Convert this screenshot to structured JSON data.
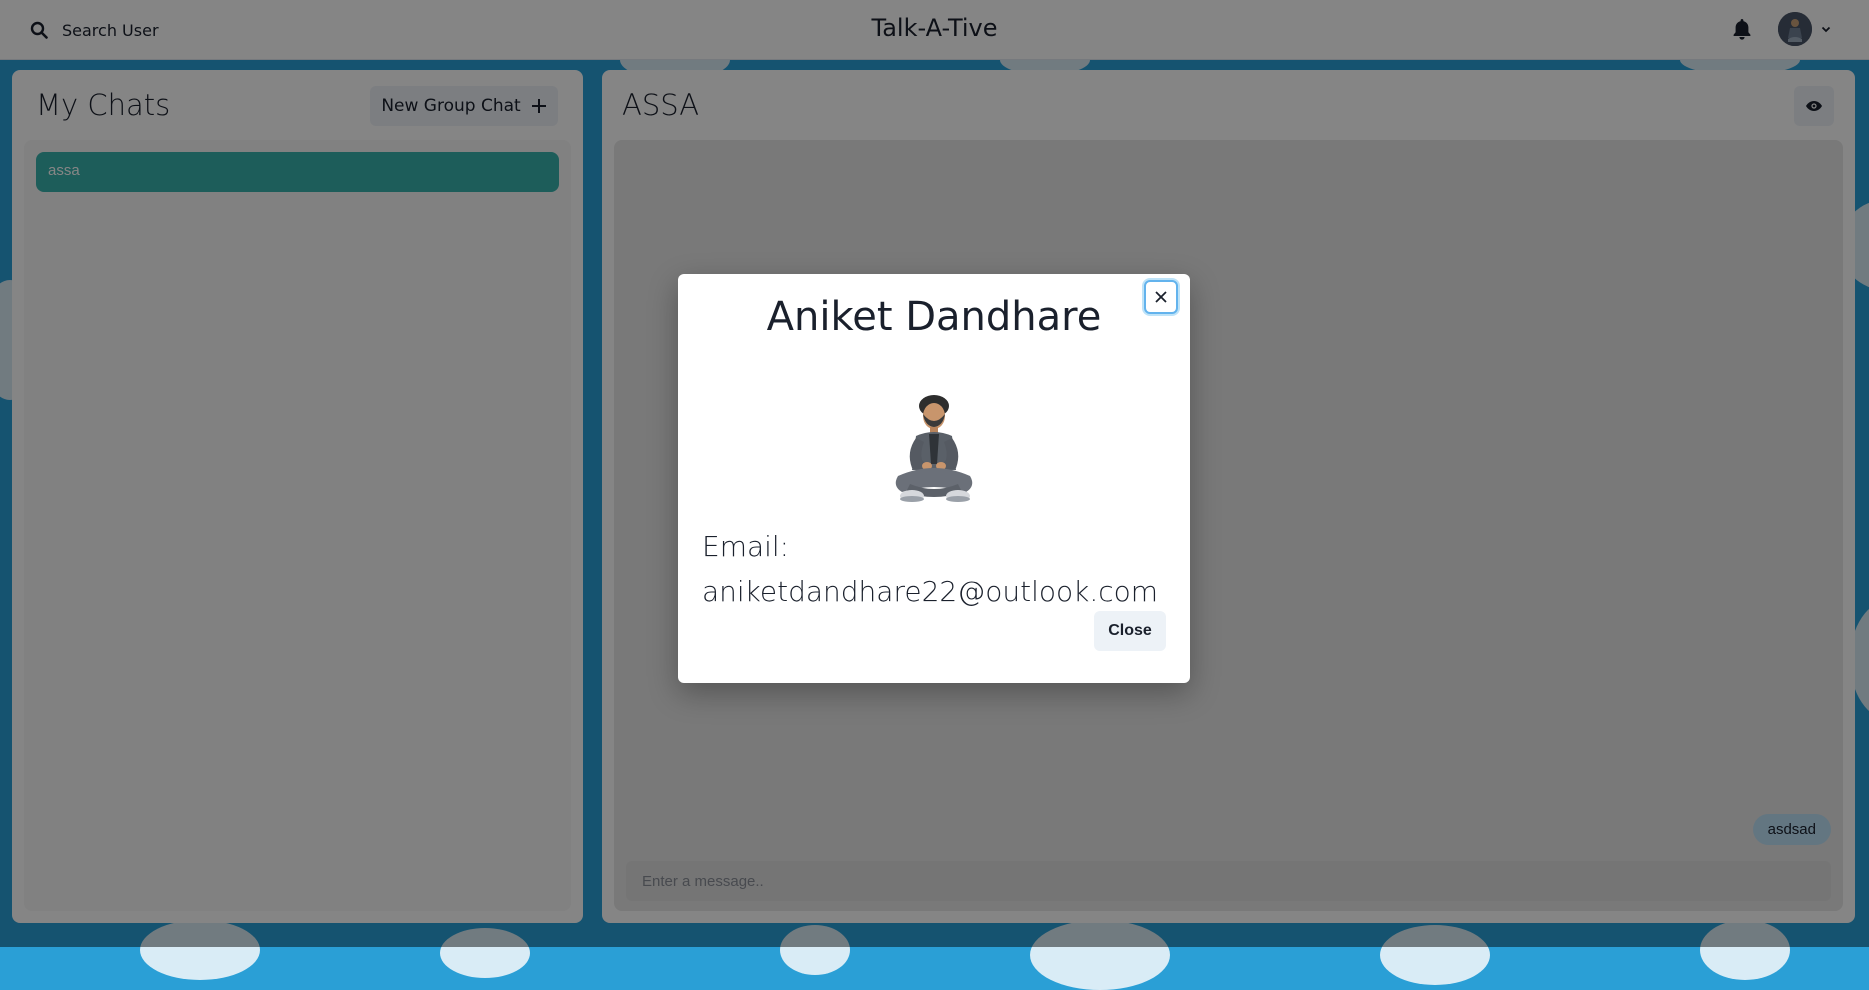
{
  "header": {
    "search_label": "Search User",
    "app_title": "Talk-A-Tive",
    "icons": [
      "search-icon",
      "bell-icon",
      "avatar",
      "chevron-down-icon"
    ]
  },
  "sidebar": {
    "title": "My Chats",
    "new_group_label": "New Group Chat",
    "chats": [
      {
        "name": "assa",
        "selected": true
      }
    ]
  },
  "chat": {
    "title": "ASSA",
    "messages": [
      {
        "text": "asdsad",
        "own": true
      }
    ],
    "input_placeholder": "Enter a message.."
  },
  "modal": {
    "name": "Aniket Dandhare",
    "email_label": "Email:",
    "email": "aniketdandhare22@outlook.com",
    "close_label": "Close"
  },
  "colors": {
    "accent_teal": "#38b2ac",
    "background_blue": "#2a9fd6",
    "message_bubble": "#bee3f8"
  }
}
